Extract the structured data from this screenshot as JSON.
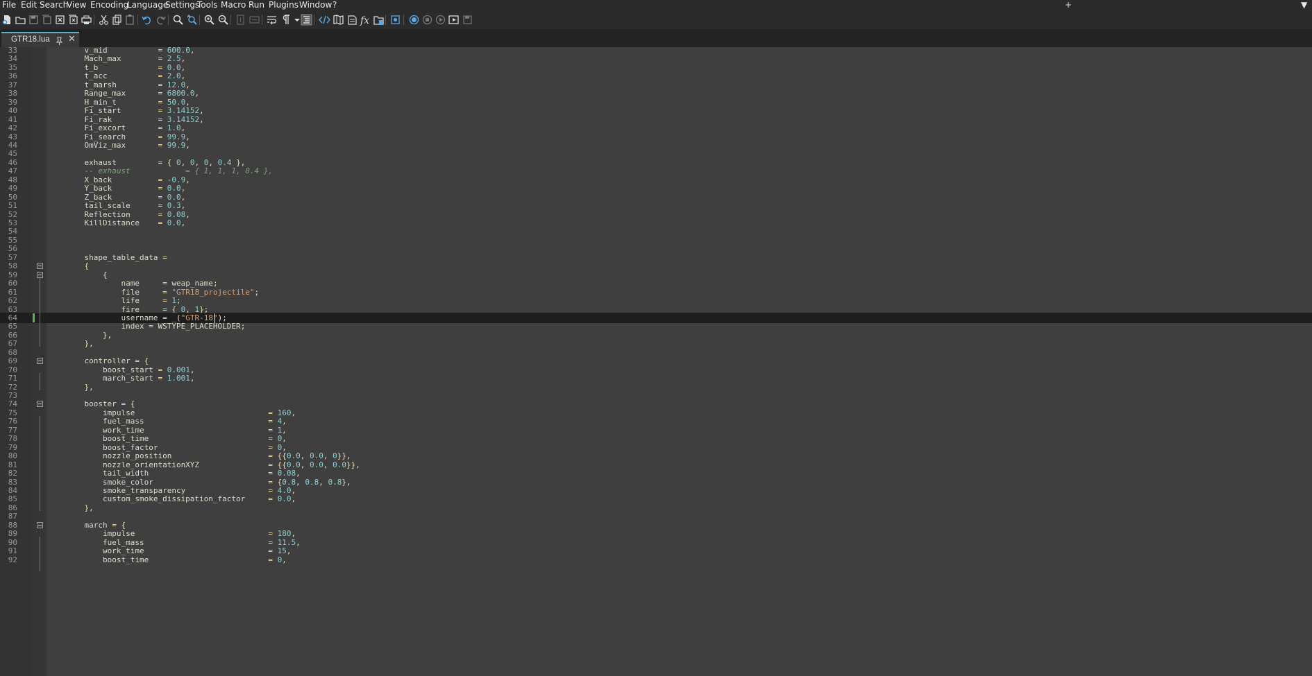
{
  "menubar": {
    "items": [
      "File",
      "Edit",
      "Search",
      "View",
      "Encoding",
      "Language",
      "Settings",
      "Tools",
      "Macro",
      "Run",
      "Plugins",
      "Window",
      "?"
    ],
    "right_controls": [
      "+",
      "▼"
    ]
  },
  "toolbar": {
    "icons": [
      "new-file-icon",
      "open-file-icon",
      "save-icon",
      "save-all-icon",
      "close-icon",
      "close-all-icon",
      "print-icon",
      "cut-icon",
      "copy-icon",
      "paste-icon",
      "undo-icon",
      "redo-icon",
      "find-icon",
      "replace-icon",
      "zoom-in-icon",
      "zoom-out-icon",
      "sync-vertical-icon",
      "sync-horizontal-icon",
      "word-wrap-icon",
      "show-all-chars-icon",
      "show-chars-dropdown-icon",
      "indent-guide-icon",
      "xml-tag-icon",
      "document-map-icon",
      "function-list-icon",
      "function-icon",
      "folder-workspace-icon",
      "monitoring-icon",
      "record-macro-icon",
      "stop-record-icon",
      "play-macro-icon",
      "run-macro-multiple-icon",
      "save-macro-icon"
    ]
  },
  "tab": {
    "title": "GTR18.lua"
  },
  "editor": {
    "lines": [
      {
        "n": "33",
        "code": "    v_mid           = 600.0,"
      },
      {
        "n": "34",
        "code": "    Mach_max        = 2.5,"
      },
      {
        "n": "35",
        "code": "    t_b             = 0.0,"
      },
      {
        "n": "36",
        "code": "    t_acc           = 2.0,"
      },
      {
        "n": "37",
        "code": "    t_marsh         = 12.0,"
      },
      {
        "n": "38",
        "code": "    Range_max       = 6800.0,"
      },
      {
        "n": "39",
        "code": "    H_min_t         = 50.0,"
      },
      {
        "n": "40",
        "code": "    Fi_start        = 3.14152,"
      },
      {
        "n": "41",
        "code": "    Fi_rak          = 3.14152,"
      },
      {
        "n": "42",
        "code": "    Fi_excort       = 1.0,"
      },
      {
        "n": "43",
        "code": "    Fi_search       = 99.9,"
      },
      {
        "n": "44",
        "code": "    OmViz_max       = 99.9,"
      },
      {
        "n": "45",
        "code": ""
      },
      {
        "n": "46",
        "code": "    exhaust         = { 0, 0, 0, 0.4 },"
      },
      {
        "n": "47",
        "code": "    -- exhaust            = { 1, 1, 1, 0.4 },"
      },
      {
        "n": "48",
        "code": "    X_back          = -0.9,"
      },
      {
        "n": "49",
        "code": "    Y_back          = 0.0,"
      },
      {
        "n": "50",
        "code": "    Z_back          = 0.0,"
      },
      {
        "n": "51",
        "code": "    tail_scale      = 0.3,"
      },
      {
        "n": "52",
        "code": "    Reflection      = 0.08,"
      },
      {
        "n": "53",
        "code": "    KillDistance    = 0.0,"
      },
      {
        "n": "54",
        "code": ""
      },
      {
        "n": "55",
        "code": ""
      },
      {
        "n": "56",
        "code": ""
      },
      {
        "n": "57",
        "code": "    shape_table_data ="
      },
      {
        "n": "58",
        "code": "    {"
      },
      {
        "n": "59",
        "code": "        {"
      },
      {
        "n": "60",
        "code": "            name     = weap_name;"
      },
      {
        "n": "61",
        "code": "            file     = \"GTR18_projectile\";"
      },
      {
        "n": "62",
        "code": "            life     = 1;"
      },
      {
        "n": "63",
        "code": "            fire     = { 0, 1};"
      },
      {
        "n": "64",
        "code": "            username = _(\"GTR-18\");"
      },
      {
        "n": "65",
        "code": "            index = WSTYPE_PLACEHOLDER;"
      },
      {
        "n": "66",
        "code": "        },"
      },
      {
        "n": "67",
        "code": "    },"
      },
      {
        "n": "68",
        "code": ""
      },
      {
        "n": "69",
        "code": "    controller = {"
      },
      {
        "n": "70",
        "code": "        boost_start = 0.001,"
      },
      {
        "n": "71",
        "code": "        march_start = 1.001,"
      },
      {
        "n": "72",
        "code": "    },"
      },
      {
        "n": "73",
        "code": ""
      },
      {
        "n": "74",
        "code": "    booster = {"
      },
      {
        "n": "75",
        "code": "        impulse                             = 160,"
      },
      {
        "n": "76",
        "code": "        fuel_mass                           = 4,"
      },
      {
        "n": "77",
        "code": "        work_time                           = 1,"
      },
      {
        "n": "78",
        "code": "        boost_time                          = 0,"
      },
      {
        "n": "79",
        "code": "        boost_factor                        = 0,"
      },
      {
        "n": "80",
        "code": "        nozzle_position                     = {{0.0, 0.0, 0}},"
      },
      {
        "n": "81",
        "code": "        nozzle_orientationXYZ               = {{0.0, 0.0, 0.0}},"
      },
      {
        "n": "82",
        "code": "        tail_width                          = 0.08,"
      },
      {
        "n": "83",
        "code": "        smoke_color                         = {0.8, 0.8, 0.8},"
      },
      {
        "n": "84",
        "code": "        smoke_transparency                  = 4.0,"
      },
      {
        "n": "85",
        "code": "        custom_smoke_dissipation_factor     = 0.0,"
      },
      {
        "n": "86",
        "code": "    },"
      },
      {
        "n": "87",
        "code": ""
      },
      {
        "n": "88",
        "code": "    march = {"
      },
      {
        "n": "89",
        "code": "        impulse                             = 180,"
      },
      {
        "n": "90",
        "code": "        fuel_mass                           = 11.5,"
      },
      {
        "n": "91",
        "code": "        work_time                           = 15,"
      },
      {
        "n": "92",
        "code": "        boost_time                          = 0,"
      }
    ]
  }
}
